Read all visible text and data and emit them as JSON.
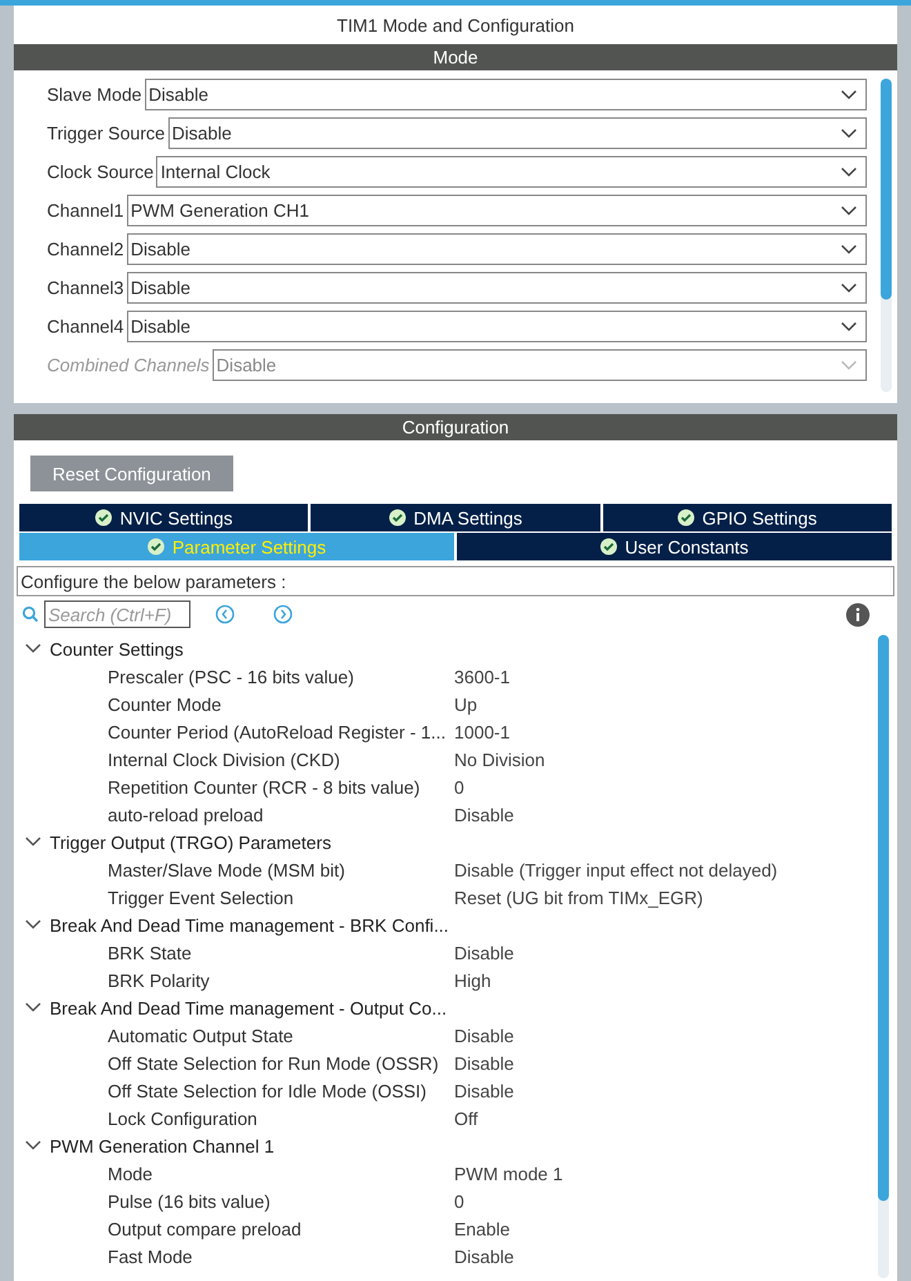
{
  "title": "TIM1 Mode and Configuration",
  "mode": {
    "header": "Mode",
    "fields": [
      {
        "label": "Slave Mode",
        "value": "Disable",
        "disabled": false
      },
      {
        "label": "Trigger Source",
        "value": "Disable",
        "disabled": false
      },
      {
        "label": "Clock Source",
        "value": "Internal Clock",
        "disabled": false
      },
      {
        "label": "Channel1",
        "value": "PWM Generation CH1",
        "disabled": false
      },
      {
        "label": "Channel2",
        "value": "Disable",
        "disabled": false
      },
      {
        "label": "Channel3",
        "value": "Disable",
        "disabled": false
      },
      {
        "label": "Channel4",
        "value": "Disable",
        "disabled": false
      },
      {
        "label": "Combined Channels",
        "value": "Disable",
        "disabled": true
      }
    ]
  },
  "configuration": {
    "header": "Configuration",
    "reset_button": "Reset Configuration",
    "tabs": [
      {
        "label": "NVIC Settings",
        "selected": false
      },
      {
        "label": "DMA Settings",
        "selected": false
      },
      {
        "label": "GPIO Settings",
        "selected": false
      },
      {
        "label": "Parameter Settings",
        "selected": true
      },
      {
        "label": "User Constants",
        "selected": false
      }
    ],
    "hint": "Configure the below parameters :",
    "search": {
      "placeholder": "Search (Ctrl+F)"
    },
    "groups": [
      {
        "label": "Counter Settings",
        "expanded": true,
        "children": [
          {
            "label": "Prescaler (PSC - 16 bits value)",
            "value": "3600-1"
          },
          {
            "label": "Counter Mode",
            "value": "Up"
          },
          {
            "label": "Counter Period (AutoReload Register - 1...",
            "value": "1000-1"
          },
          {
            "label": "Internal Clock Division (CKD)",
            "value": "No Division"
          },
          {
            "label": "Repetition Counter (RCR - 8 bits value)",
            "value": "0"
          },
          {
            "label": "auto-reload preload",
            "value": "Disable"
          }
        ]
      },
      {
        "label": "Trigger Output (TRGO) Parameters",
        "expanded": true,
        "children": [
          {
            "label": "Master/Slave Mode (MSM bit)",
            "value": "Disable (Trigger input effect not delayed)"
          },
          {
            "label": "Trigger Event Selection",
            "value": "Reset (UG bit from TIMx_EGR)"
          }
        ]
      },
      {
        "label": "Break And Dead Time management - BRK Confi...",
        "expanded": true,
        "children": [
          {
            "label": "BRK State",
            "value": "Disable"
          },
          {
            "label": "BRK Polarity",
            "value": "High"
          }
        ]
      },
      {
        "label": "Break And Dead Time management - Output Co...",
        "expanded": true,
        "children": [
          {
            "label": "Automatic Output State",
            "value": "Disable"
          },
          {
            "label": "Off State Selection for Run Mode (OSSR)",
            "value": "Disable"
          },
          {
            "label": "Off State Selection for Idle Mode (OSSI)",
            "value": "Disable"
          },
          {
            "label": "Lock Configuration",
            "value": "Off"
          }
        ]
      },
      {
        "label": "PWM Generation Channel 1",
        "expanded": true,
        "children": [
          {
            "label": "Mode",
            "value": "PWM mode 1"
          },
          {
            "label": "Pulse (16 bits value)",
            "value": "0"
          },
          {
            "label": "Output compare preload",
            "value": "Enable"
          },
          {
            "label": "Fast Mode",
            "value": "Disable"
          }
        ]
      }
    ]
  }
}
